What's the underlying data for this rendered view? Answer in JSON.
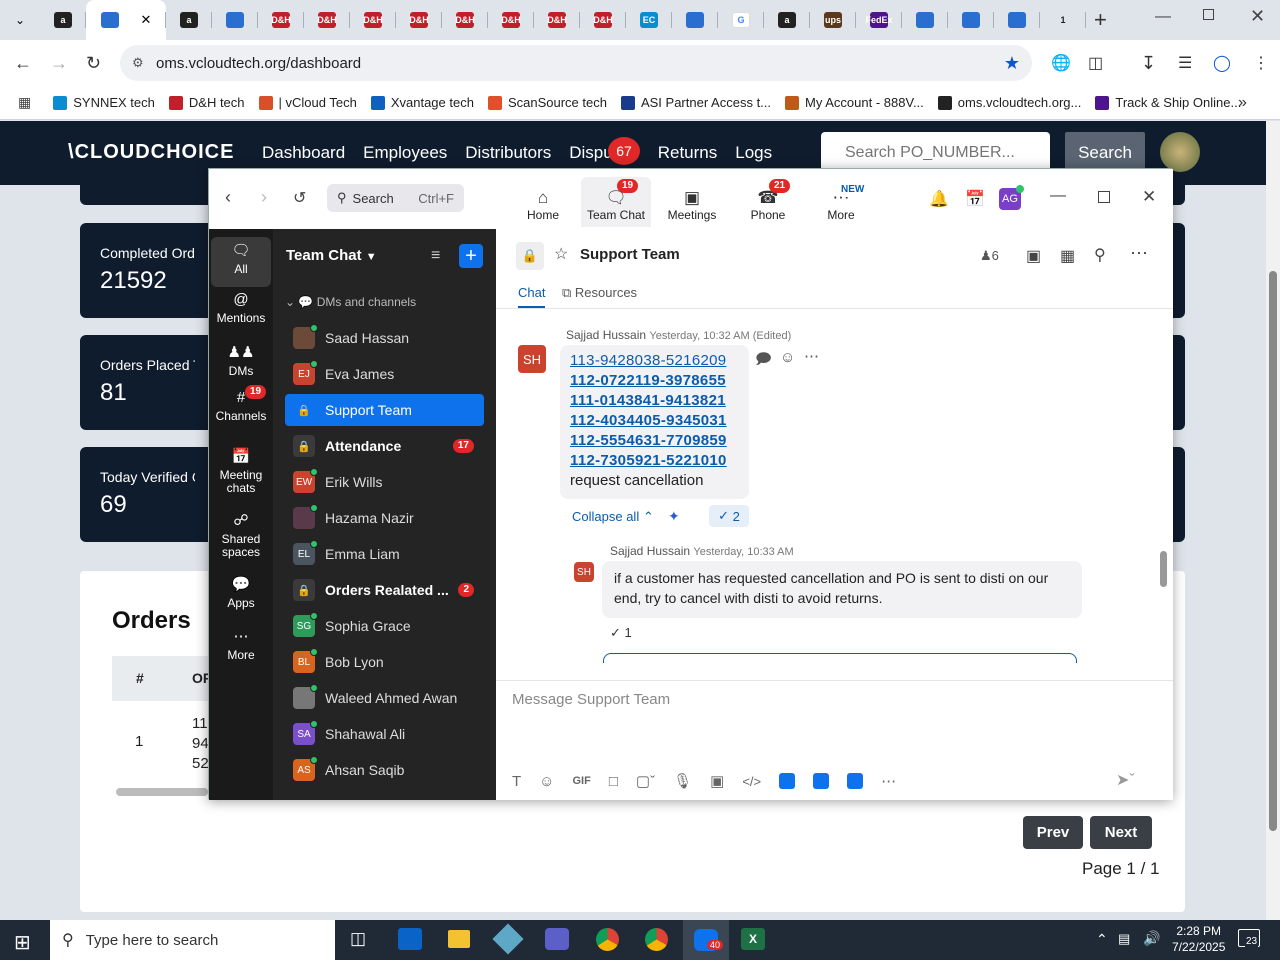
{
  "browser": {
    "tabs": [
      "a",
      "",
      "a",
      "",
      "D&H",
      "D&H",
      "D&H",
      "D&H",
      "D&H",
      "D&H",
      "D&H",
      "D&H",
      "EC",
      "",
      "G",
      "a",
      "ups",
      "FedEx",
      "",
      "",
      "",
      "1"
    ],
    "url": "oms.vcloudtech.org/dashboard",
    "bookmarks": [
      "SYNNEX tech",
      "D&H tech",
      "| vCloud Tech",
      "Xvantage tech",
      "ScanSource tech",
      "ASI Partner Access t...",
      "My Account - 888V...",
      "oms.vcloudtech.org...",
      "Track & Ship Online..."
    ]
  },
  "site": {
    "logo": "CLOUDCHOICE",
    "nav": [
      "Dashboard",
      "Employees",
      "Distributors",
      "Dispu",
      "Returns",
      "Logs"
    ],
    "disputes_badge": "67",
    "search_placeholder": "Search PO_NUMBER...",
    "search_button": "Search",
    "cards": [
      {
        "title": "Completed Orders",
        "value": "21592"
      },
      {
        "title": "Orders Placed Today",
        "value": "81"
      },
      {
        "title": "Today Verified Orders",
        "value": "69"
      }
    ],
    "orders_title": "Orders",
    "table_headers": [
      "#",
      "OR"
    ],
    "table_row": {
      "num": "1",
      "po_fragments": [
        "11",
        "94",
        "52"
      ]
    },
    "prev": "Prev",
    "next": "Next",
    "page": "Page 1 / 1"
  },
  "zoom": {
    "search_label": "Search",
    "search_shortcut": "Ctrl+F",
    "tabs": [
      {
        "label": "Home",
        "badge": ""
      },
      {
        "label": "Team Chat",
        "badge": "19"
      },
      {
        "label": "Meetings",
        "badge": ""
      },
      {
        "label": "Phone",
        "badge": "21"
      },
      {
        "label": "More",
        "badge": "NEW"
      }
    ],
    "avatar": "AG",
    "rail": [
      {
        "label": "All",
        "badge": ""
      },
      {
        "label": "Mentions",
        "badge": ""
      },
      {
        "label": "DMs",
        "badge": ""
      },
      {
        "label": "Channels",
        "badge": "19"
      },
      {
        "label": "Meeting chats",
        "badge": ""
      },
      {
        "label": "Shared spaces",
        "badge": ""
      },
      {
        "label": "Apps",
        "badge": ""
      },
      {
        "label": "More",
        "badge": ""
      }
    ],
    "list_title": "Team Chat",
    "section": "DMs and channels",
    "items": [
      {
        "name": "Saad Hassan",
        "initials": "",
        "color": "#6b4a3a",
        "count": "",
        "bold": false,
        "lock": false
      },
      {
        "name": "Eva James",
        "initials": "EJ",
        "color": "#c9432f",
        "count": "",
        "bold": false,
        "lock": false
      },
      {
        "name": "Support Team",
        "initials": "",
        "color": "",
        "count": "",
        "bold": false,
        "lock": true,
        "active": true
      },
      {
        "name": "Attendance",
        "initials": "",
        "color": "",
        "count": "17",
        "bold": true,
        "lock": true
      },
      {
        "name": "Erik Wills",
        "initials": "EW",
        "color": "#c9432f",
        "count": "",
        "bold": false,
        "lock": false
      },
      {
        "name": "Hazama Nazir",
        "initials": "",
        "color": "#5a3a4a",
        "count": "",
        "bold": false,
        "lock": false
      },
      {
        "name": "Emma Liam",
        "initials": "EL",
        "color": "#4a5560",
        "count": "",
        "bold": false,
        "lock": false
      },
      {
        "name": "Orders Realated ...",
        "initials": "",
        "color": "",
        "count": "2",
        "bold": true,
        "lock": true
      },
      {
        "name": "Sophia Grace",
        "initials": "SG",
        "color": "#2e9b5b",
        "count": "",
        "bold": false,
        "lock": false
      },
      {
        "name": "Bob Lyon",
        "initials": "BL",
        "color": "#d9641e",
        "count": "",
        "bold": false,
        "lock": false
      },
      {
        "name": "Waleed Ahmed Awan",
        "initials": "",
        "color": "#777",
        "count": "",
        "bold": false,
        "lock": false
      },
      {
        "name": "Shahawal Ali",
        "initials": "SA",
        "color": "#7b4fc9",
        "count": "",
        "bold": false,
        "lock": false
      },
      {
        "name": "Ahsan Saqib",
        "initials": "AS",
        "color": "#d9641e",
        "count": "",
        "bold": false,
        "lock": false
      }
    ],
    "channel": {
      "name": "Support Team",
      "members": "6",
      "tab_chat": "Chat",
      "tab_resources": "Resources"
    },
    "message1": {
      "avatar": "SH",
      "sender": "Sajjad Hussain",
      "time": "Yesterday, 10:32 AM (Edited)",
      "links": [
        "113-9428038-5216209",
        "112-0722119-3978655",
        "111-0143841-9413821",
        "112-4034405-9345031",
        "112-5554631-7709859",
        "112-7305921-5221010"
      ],
      "text": "request cancellation",
      "collapse": "Collapse all",
      "reaction_count": "2"
    },
    "message2": {
      "avatar": "SH",
      "sender": "Sajjad Hussain",
      "time": "Yesterday, 10:33 AM",
      "text": "if a customer has requested cancellation and PO is sent to disti on our end, try to cancel with disti to avoid returns.",
      "reaction_count": "1"
    },
    "composer_placeholder": "Message Support Team"
  },
  "taskbar": {
    "search": "Type here to search",
    "time": "2:28 PM",
    "date": "7/22/2025",
    "zoom_badge": "40",
    "notif": "23"
  }
}
